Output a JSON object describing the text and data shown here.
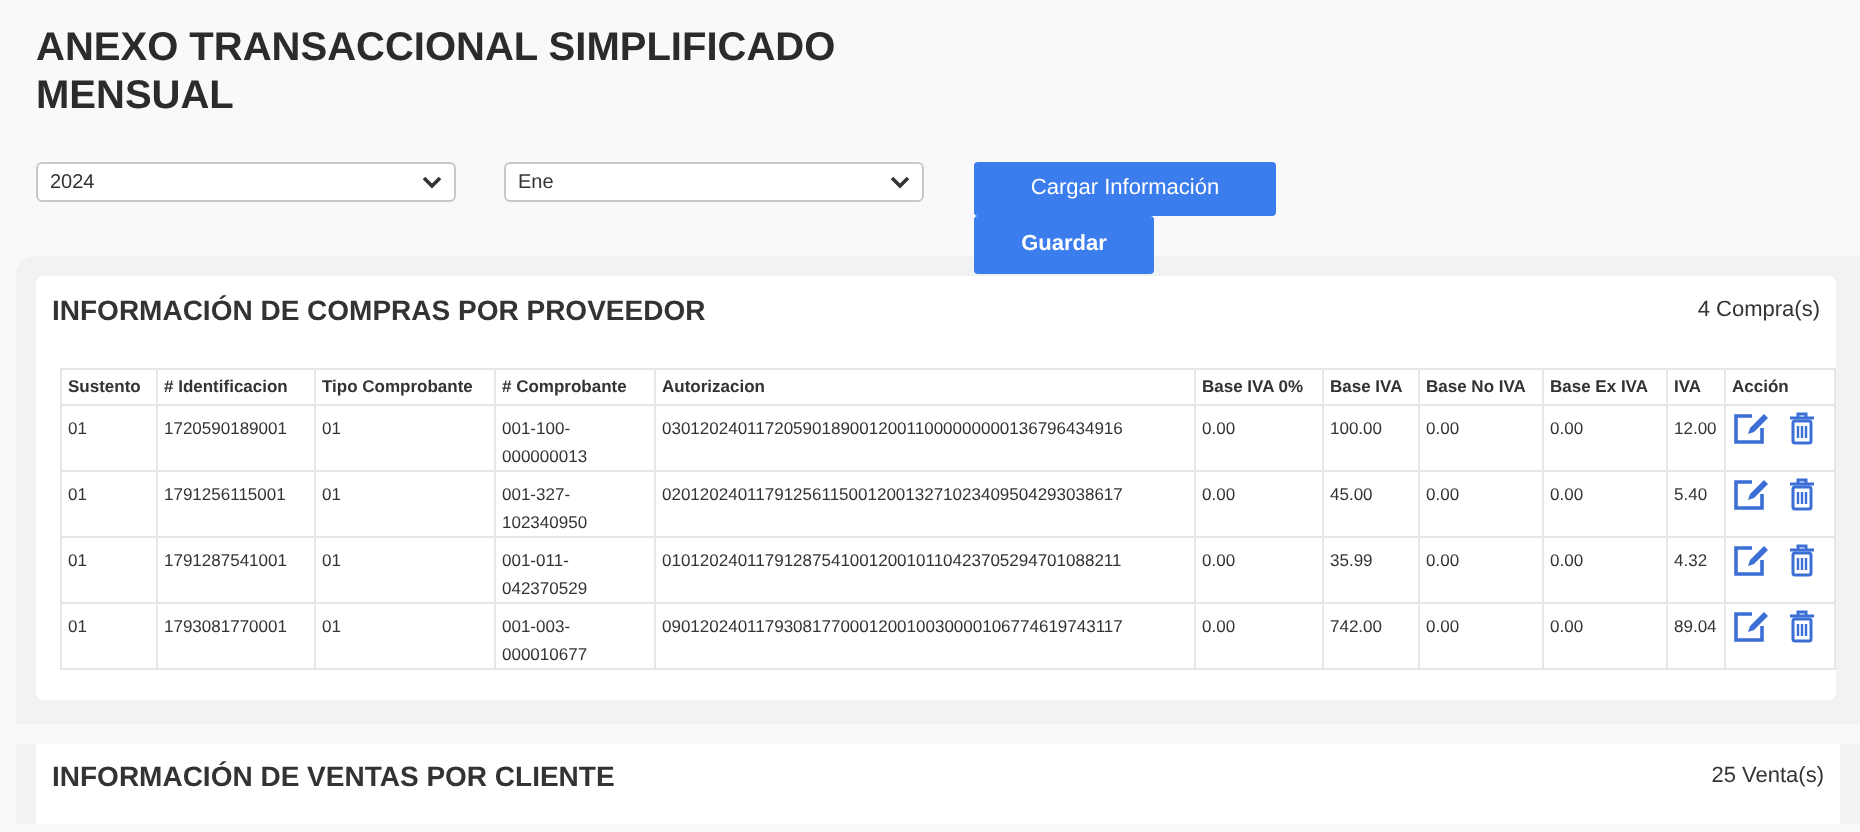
{
  "title": "ANEXO TRANSACCIONAL SIMPLIFICADO MENSUAL",
  "filters": [
    {
      "value": "2024"
    },
    {
      "value": "Ene"
    }
  ],
  "buttons": [
    "Cargar Información",
    "Guardar"
  ],
  "purchases": {
    "heading": "INFORMACIÓN DE COMPRAS POR PROVEEDOR",
    "count": "4 Compra(s)",
    "columns": [
      "Sustento",
      "# Identificacion",
      "Tipo Comprobante",
      "# Comprobante",
      "Autorizacion",
      "Base IVA 0%",
      "Base IVA",
      "Base No IVA",
      "Base Ex IVA",
      "IVA",
      "Acción"
    ],
    "rows": [
      [
        "01",
        "1720590189001",
        "01",
        "001-100-000000013",
        "0301202401172059018900120011000000000136796434916",
        "0.00",
        "100.00",
        "0.00",
        "0.00",
        "12.00"
      ],
      [
        "01",
        "1791256115001",
        "01",
        "001-327-102340950",
        "0201202401179125611500120013271023409504293038617",
        "0.00",
        "45.00",
        "0.00",
        "0.00",
        "5.40"
      ],
      [
        "01",
        "1791287541001",
        "01",
        "001-011-042370529",
        "0101202401179128754100120010110423705294701088211",
        "0.00",
        "35.99",
        "0.00",
        "0.00",
        "4.32"
      ],
      [
        "01",
        "1793081770001",
        "01",
        "001-003-000010677",
        "0901202401179308177000120010030000106774619743117",
        "0.00",
        "742.00",
        "0.00",
        "0.00",
        "89.04"
      ]
    ]
  },
  "sales": {
    "heading": "INFORMACIÓN DE VENTAS POR CLIENTE",
    "count": "25 Venta(s)"
  }
}
